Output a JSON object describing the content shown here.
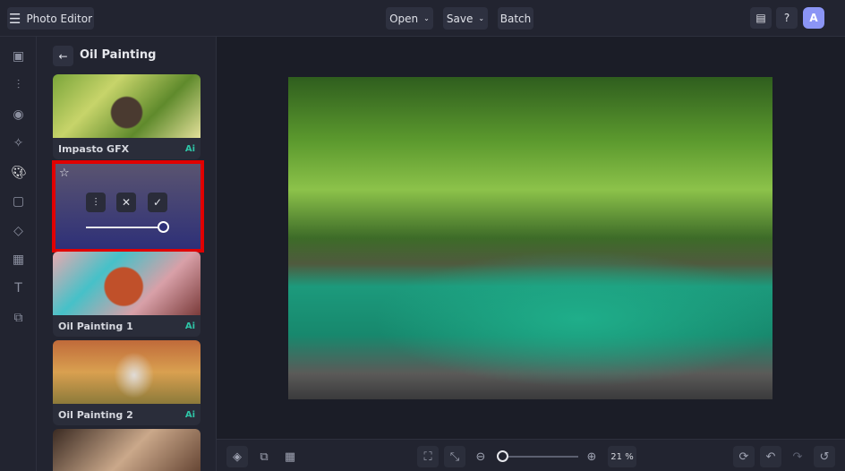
{
  "header": {
    "app_title": "Photo Editor",
    "menu": [
      "Open",
      "Save",
      "Batch"
    ],
    "avatar_letter": "A"
  },
  "sidebar": {
    "icons": [
      "image-icon",
      "adjust-icon",
      "eye-icon",
      "sparkle-icon",
      "palette-icon",
      "frame-icon",
      "shapes-icon",
      "texture-icon",
      "text-icon",
      "overlay-icon"
    ]
  },
  "panel": {
    "title": "Oil Painting",
    "cards": [
      {
        "label": "Impasto GFX",
        "badge": "Ai"
      },
      {
        "label": "Oil Painting 1",
        "badge": "Ai"
      },
      {
        "label": "Oil Painting 2",
        "badge": "Ai"
      }
    ],
    "selected_intensity": 1.0
  },
  "footer": {
    "zoom": "21 %",
    "zoom_level": 0.05
  },
  "colors": {
    "accent": "#8b95f5",
    "highlight": "#e10000",
    "ai": "#2ec4a6"
  }
}
